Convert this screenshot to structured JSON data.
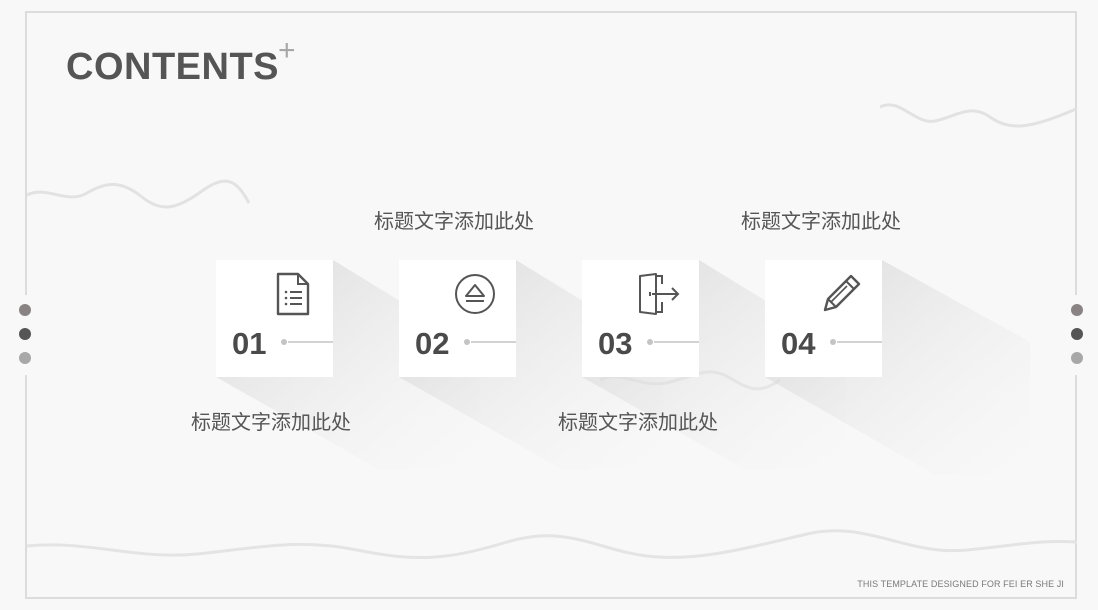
{
  "slide": {
    "title": "CONTENTS",
    "plus": "+",
    "footer": "THIS TEMPLATE DESIGNED FOR FEI ER SHE JI"
  },
  "items": [
    {
      "number": "01",
      "label": "标题文字添加此处",
      "icon": "document-list-icon"
    },
    {
      "number": "02",
      "label": "标题文字添加此处",
      "icon": "eject-icon"
    },
    {
      "number": "03",
      "label": "标题文字添加此处",
      "icon": "exit-door-icon"
    },
    {
      "number": "04",
      "label": "标题文字添加此处",
      "icon": "pencil-icon"
    }
  ],
  "colors": {
    "dot_top": "#8a8383",
    "dot_middle": "#555555",
    "dot_bottom": "#a8a8a8",
    "accent_gray": "#555555"
  }
}
